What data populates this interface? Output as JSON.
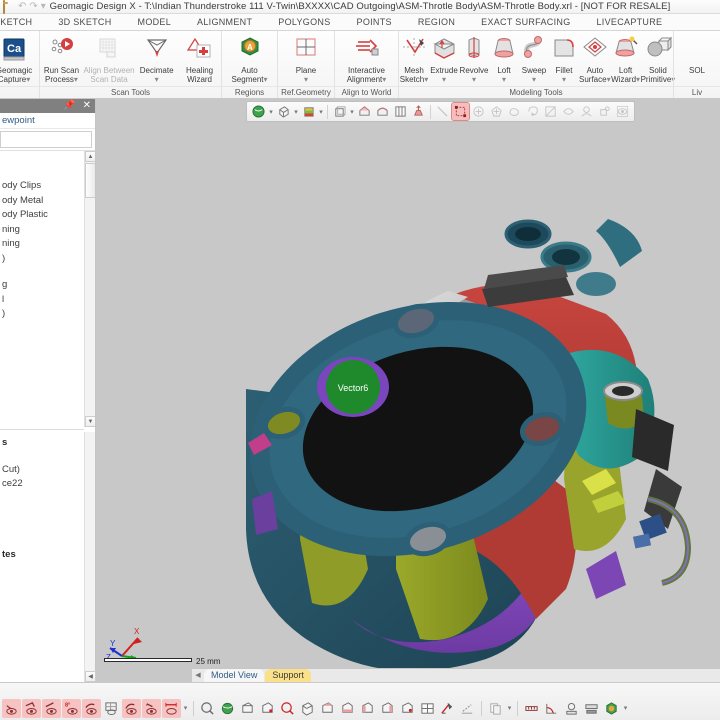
{
  "window": {
    "title": "Geomagic Design X - T:\\Indian Thunderstroke 111 V-Twin\\BXXXX\\CAD Outgoing\\ASM-Throtle Body\\ASM-Throtle Body.xrl - [NOT FOR RESALE]",
    "quick_access": [
      "open-icon",
      "undo-icon",
      "redo-icon",
      "customize-qat-icon"
    ]
  },
  "menu": {
    "tabs": [
      "SKETCH",
      "3D SKETCH",
      "MODEL",
      "ALIGNMENT",
      "POLYGONS",
      "POINTS",
      "REGION",
      "EXACT SURFACING",
      "LIVECAPTURE"
    ]
  },
  "ribbon": {
    "groups": [
      {
        "label": "",
        "buttons": [
          {
            "name": "geomagic-capture",
            "line1": "Geomagic",
            "line2": "Capture",
            "dropdown": true,
            "icon": "capture-icon",
            "disabled": false
          }
        ]
      },
      {
        "label": "Scan Tools",
        "buttons": [
          {
            "name": "run-scan-process",
            "line1": "Run Scan",
            "line2": "Process",
            "dropdown": true,
            "icon": "run-scan-icon",
            "disabled": false
          },
          {
            "name": "align-between-scan-data",
            "line1": "Align Between",
            "line2": "Scan Data",
            "dropdown": false,
            "icon": "align-scan-icon",
            "disabled": true
          },
          {
            "name": "decimate",
            "line1": "Decimate",
            "line2": "",
            "dropdown": true,
            "icon": "decimate-icon",
            "disabled": false
          },
          {
            "name": "healing-wizard",
            "line1": "Healing",
            "line2": "Wizard",
            "dropdown": false,
            "icon": "healing-wizard-icon",
            "disabled": false
          }
        ]
      },
      {
        "label": "Regions",
        "buttons": [
          {
            "name": "auto-segment",
            "line1": "Auto",
            "line2": "Segment",
            "dropdown": true,
            "icon": "auto-segment-icon",
            "disabled": false
          }
        ]
      },
      {
        "label": "Ref.Geometry",
        "buttons": [
          {
            "name": "plane",
            "line1": "Plane",
            "line2": "",
            "dropdown": true,
            "icon": "plane-icon",
            "disabled": false
          }
        ]
      },
      {
        "label": "Align to World",
        "buttons": [
          {
            "name": "interactive-alignment",
            "line1": "Interactive",
            "line2": "Alignment",
            "dropdown": true,
            "icon": "interactive-align-icon",
            "disabled": false
          }
        ]
      },
      {
        "label": "Modeling Tools",
        "buttons": [
          {
            "name": "mesh-sketch",
            "line1": "Mesh",
            "line2": "Sketch",
            "dropdown": true,
            "icon": "mesh-sketch-icon",
            "disabled": false
          },
          {
            "name": "extrude",
            "line1": "Extrude",
            "line2": "",
            "dropdown": true,
            "icon": "extrude-icon",
            "disabled": false
          },
          {
            "name": "revolve",
            "line1": "Revolve",
            "line2": "",
            "dropdown": true,
            "icon": "revolve-icon",
            "disabled": false
          },
          {
            "name": "loft",
            "line1": "Loft",
            "line2": "",
            "dropdown": true,
            "icon": "loft-icon",
            "disabled": false
          },
          {
            "name": "sweep",
            "line1": "Sweep",
            "line2": "",
            "dropdown": true,
            "icon": "sweep-icon",
            "disabled": false
          },
          {
            "name": "fillet",
            "line1": "Fillet",
            "line2": "",
            "dropdown": true,
            "icon": "fillet-icon",
            "disabled": false
          },
          {
            "name": "auto-surface",
            "line1": "Auto",
            "line2": "Surface",
            "dropdown": true,
            "icon": "auto-surface-icon",
            "disabled": false
          },
          {
            "name": "loft-wizard",
            "line1": "Loft",
            "line2": "Wizard",
            "dropdown": true,
            "icon": "loft-wizard-icon",
            "disabled": false
          },
          {
            "name": "solid-primitive",
            "line1": "Solid",
            "line2": "Primitive",
            "dropdown": true,
            "icon": "solid-primitive-icon",
            "disabled": false
          }
        ]
      },
      {
        "label": "Liv",
        "buttons": [
          {
            "name": "solidworks",
            "line1": "SOL",
            "line2": "",
            "dropdown": false,
            "icon": "solidworks-icon",
            "disabled": false
          }
        ]
      }
    ]
  },
  "left_panel": {
    "header_title": "ewpoint",
    "pin_icon": "pin-icon",
    "close_icon": "close-icon",
    "tree_nodes": [
      "ody Clips",
      "ody Metal",
      "ody Plastic",
      "ning",
      "ning",
      ")"
    ],
    "tree_nodes_2": [
      "g",
      "l",
      ")"
    ],
    "lower_sections": [
      {
        "header": "s",
        "items": [
          "Cut)",
          "ce22"
        ]
      },
      {
        "header": "tes",
        "items": []
      }
    ],
    "scroll_up_icon": "scroll-up-icon",
    "scroll_down_icon": "scroll-down-icon"
  },
  "viewport": {
    "background_color": "#c8c8c8",
    "toolbar": [
      {
        "name": "render-shaded-icon",
        "group": 1,
        "dropdown": true,
        "selected": false,
        "dim": false
      },
      {
        "name": "render-wireframe-icon",
        "group": 1,
        "dropdown": true,
        "selected": false,
        "dim": false
      },
      {
        "name": "render-color-icon",
        "group": 1,
        "dropdown": true,
        "selected": false,
        "dim": false
      },
      {
        "name": "view-bounding-box-icon",
        "group": 2,
        "dropdown": true,
        "selected": false,
        "dim": false
      },
      {
        "name": "section-view-icon",
        "group": 2,
        "dropdown": false,
        "selected": false,
        "dim": false
      },
      {
        "name": "clipping-plane-icon",
        "group": 2,
        "dropdown": false,
        "selected": false,
        "dim": false
      },
      {
        "name": "split-view-icon",
        "group": 2,
        "dropdown": false,
        "selected": false,
        "dim": false
      },
      {
        "name": "light-source-icon",
        "group": 2,
        "dropdown": false,
        "selected": false,
        "dim": false
      },
      {
        "name": "select-line-icon",
        "group": 3,
        "dropdown": false,
        "selected": false,
        "dim": true
      },
      {
        "name": "select-rectangle-icon",
        "group": 3,
        "dropdown": false,
        "selected": true,
        "dim": false
      },
      {
        "name": "select-circle-icon",
        "group": 3,
        "dropdown": false,
        "selected": false,
        "dim": true
      },
      {
        "name": "select-polygon-icon",
        "group": 3,
        "dropdown": false,
        "selected": false,
        "dim": true
      },
      {
        "name": "select-freeform-icon",
        "group": 3,
        "dropdown": false,
        "selected": false,
        "dim": true
      },
      {
        "name": "select-lasso-icon",
        "group": 3,
        "dropdown": false,
        "selected": false,
        "dim": true
      },
      {
        "name": "select-paint-icon",
        "group": 3,
        "dropdown": false,
        "selected": false,
        "dim": true
      },
      {
        "name": "deselect-icon",
        "group": 3,
        "dropdown": false,
        "selected": false,
        "dim": true
      },
      {
        "name": "select-visible-icon",
        "group": 3,
        "dropdown": false,
        "selected": false,
        "dim": true
      },
      {
        "name": "select-backface-icon",
        "group": 3,
        "dropdown": false,
        "selected": false,
        "dim": true
      },
      {
        "name": "visibility-icon",
        "group": 3,
        "dropdown": false,
        "selected": false,
        "dim": true
      }
    ],
    "scale_label": "25 mm",
    "axis_labels": {
      "x": "X",
      "y": "Y",
      "z": "Z"
    },
    "annotation": "Vector6"
  },
  "panel_tabs": {
    "collapse_icon": "collapse-left-icon",
    "tabs": [
      {
        "label": "Model View",
        "active": false
      },
      {
        "label": "Support",
        "active": true
      }
    ]
  },
  "status_toolbar": {
    "left_icons": [
      "show-point-cloud-icon",
      "show-mesh-icon",
      "show-poly-edge-icon",
      "show-angle-icon",
      "show-curvature-icon",
      "show-grid-icon",
      "show-sketch-icon",
      "show-vector-icon",
      "show-dimension-icon"
    ],
    "right_icons": [
      "zoom-fit-icon",
      "rotate-view-icon",
      "front-view-icon",
      "back-view-icon",
      "zoom-window-icon",
      "iso-view-icon",
      "top-view-icon",
      "bottom-view-icon",
      "left-view-icon",
      "right-view-icon",
      "rear-view-icon",
      "four-view-icon",
      "measure-deviation-icon",
      "measure-distance-icon",
      "copy-view-icon",
      "ruler-icon",
      "angle-measure-icon",
      "point-measure-icon",
      "section-measure-icon",
      "globe-view-icon"
    ]
  },
  "colors": {
    "accent_red": "#d96a6a",
    "selection_pink": "#f6bdbd",
    "tab_active": "#fbe08a",
    "panel_header": "#808080",
    "viewport_bg": "#c8c8c8",
    "link_blue": "#2f5c87"
  }
}
